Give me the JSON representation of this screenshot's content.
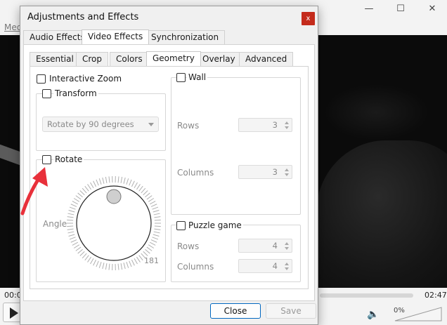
{
  "player": {
    "menu_partial": "Med",
    "time_elapsed": "00:0",
    "time_total": "02:47",
    "volume": "0%"
  },
  "dialog": {
    "title": "Adjustments and Effects",
    "close_symbol": "x",
    "main_tabs": [
      "Audio Effects",
      "Video Effects",
      "Synchronization"
    ],
    "active_main_tab": "Video Effects",
    "sub_tabs": [
      "Essential",
      "Crop",
      "Colors",
      "Geometry",
      "Overlay",
      "Advanced"
    ],
    "active_sub_tab": "Geometry",
    "buttons": {
      "close": "Close",
      "save": "Save"
    }
  },
  "geometry": {
    "interactive_zoom": {
      "label": "Interactive Zoom",
      "checked": false
    },
    "transform": {
      "label": "Transform",
      "checked": false,
      "select_value": "Rotate by 90 degrees"
    },
    "rotate": {
      "label": "Rotate",
      "checked": false,
      "angle_label": "Angle",
      "angle_value": "181"
    },
    "wall": {
      "label": "Wall",
      "checked": false,
      "rows_label": "Rows",
      "rows_value": "3",
      "columns_label": "Columns",
      "columns_value": "3"
    },
    "puzzle": {
      "label": "Puzzle game",
      "checked": false,
      "rows_label": "Rows",
      "rows_value": "4",
      "columns_label": "Columns",
      "columns_value": "4"
    }
  },
  "colors": {
    "accent": "#0067c0",
    "close_button": "#c42b1c",
    "annotation_arrow": "#e8303a"
  }
}
